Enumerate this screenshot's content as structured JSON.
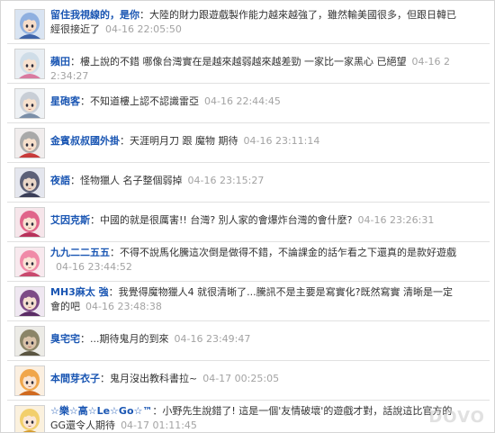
{
  "comments": [
    {
      "id": "c1",
      "user": "留住我視線的，是你",
      "sep": "：",
      "text": "大陸的財力跟遊戲製作能力越來越強了，雖然輸美國很多，但跟日韓已經很接近了",
      "time": "04-16 22:05:50",
      "avatar_icon": "anime-girl-blue-hair-avatar",
      "colors": {
        "bg": "#d9e4f2",
        "hair": "#8fb0e0",
        "face": "#f6dcc8",
        "accent": "#3e63a8"
      }
    },
    {
      "id": "c2",
      "user": "蘋田",
      "sep": "：",
      "text": "樓上說的不錯 哪像台灣實在是越來越弱越來越差勁 一家比一家黑心 已絕望",
      "time": "04-16 22:34:27",
      "avatar_icon": "anime-girl-pink-hair-avatar",
      "colors": {
        "bg": "#e9eef3",
        "hair": "#cfdde8",
        "face": "#f7e1cf",
        "accent": "#d97aa0"
      }
    },
    {
      "id": "c3",
      "user": "星砲客",
      "sep": "：",
      "text": "不知道樓上認不認識雷亞",
      "time": "04-16 22:44:45",
      "avatar_icon": "anime-boy-white-hair-avatar",
      "colors": {
        "bg": "#eef1f4",
        "hair": "#c8ced6",
        "face": "#f6e0cc",
        "accent": "#7b8fa8"
      }
    },
    {
      "id": "c4",
      "user": "金賓叔叔國外掛",
      "sep": "：",
      "text": "天涯明月刀 跟 魔物 期待",
      "time": "04-16 23:11:14",
      "avatar_icon": "anime-santa-hat-avatar",
      "colors": {
        "bg": "#f1eded",
        "hair": "#a9a9a9",
        "face": "#f6dfcb",
        "accent": "#c83a3a"
      }
    },
    {
      "id": "c5",
      "user": "夜語",
      "sep": "：",
      "text": "怪物獵人 名子整個弱掉",
      "time": "04-16 23:15:27",
      "avatar_icon": "anime-knight-dark-avatar",
      "colors": {
        "bg": "#e4e6ee",
        "hair": "#5c6077",
        "face": "#e9d6c7",
        "accent": "#3a3e58"
      }
    },
    {
      "id": "c6",
      "user": "艾因克斯",
      "sep": "：",
      "text": "中國的就是很厲害!! 台灣? 別人家的會爆炸台灣的會什麼?",
      "time": "04-16 23:26:31",
      "avatar_icon": "anime-girl-pink-hair-avatar",
      "colors": {
        "bg": "#f6e5ea",
        "hair": "#e0648a",
        "face": "#f8e2d2",
        "accent": "#b8315b"
      }
    },
    {
      "id": "c7",
      "user": "九九二二五五",
      "sep": "：",
      "text": "不得不說馬化騰這次倒是做得不錯，不論課金的話乍看之下還真的是款好遊戲",
      "time": "04-16 23:44:52",
      "avatar_icon": "anime-girl-rose-hair-avatar",
      "colors": {
        "bg": "#f8e9ee",
        "hair": "#f08aa8",
        "face": "#fae4d6",
        "accent": "#c9496e"
      }
    },
    {
      "id": "c8",
      "user": "MH3麻太 強",
      "sep": "：",
      "text": "我覺得魔物獵人4 就很清晰了...騰訊不是主要是寫實化?既然寫實 清晰是一定會的吧",
      "time": "04-16 23:48:38",
      "avatar_icon": "anime-girl-purple-hair-avatar",
      "colors": {
        "bg": "#efe7f1",
        "hair": "#7d4b86",
        "face": "#f5dfcf",
        "accent": "#5b2c66"
      }
    },
    {
      "id": "c9",
      "user": "臭宅宅",
      "sep": "：",
      "text": "...期待鬼月的到來",
      "time": "04-16 23:49:47",
      "avatar_icon": "armored-warrior-avatar",
      "colors": {
        "bg": "#ecebe6",
        "hair": "#8b8568",
        "face": "#d9c2a8",
        "accent": "#5a5541"
      }
    },
    {
      "id": "c10",
      "user": "本間芽衣子",
      "sep": "：",
      "text": "鬼月沒出教科書拉~",
      "time": "04-17 00:25:05",
      "avatar_icon": "anime-girl-orange-hair-avatar",
      "colors": {
        "bg": "#fbefe0",
        "hair": "#f0a64b",
        "face": "#fae3cf",
        "accent": "#d06a1f"
      }
    },
    {
      "id": "c11",
      "user": "☆樂☆高☆Le☆Go☆™",
      "sep": "：",
      "text": "小野先生說錯了! 這是一個'友情破壞'的遊戲才對，話說這比官方的GG還令人期待",
      "time": "04-17 01:11:45",
      "avatar_icon": "anime-blonde-girl-avatar",
      "colors": {
        "bg": "#fbf1de",
        "hair": "#f2cf6c",
        "face": "#fbe6d3",
        "accent": "#d49a2a"
      }
    }
  ],
  "watermark": "DOVO"
}
